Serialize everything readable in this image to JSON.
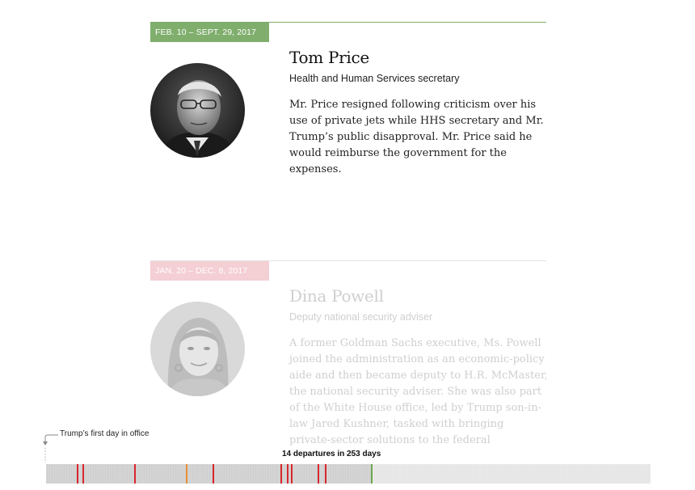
{
  "cards": [
    {
      "date_range": "FEB. 10 – SEPT. 29, 2017",
      "name": "Tom Price",
      "role": "Health and Human Services secretary",
      "description": "Mr. Price resigned following criticism over his use of private jets while HHS secretary and Mr. Trump’s public disapproval. Mr. Price said he would reimburse the government for the expenses.",
      "tag_color": "#7fae6d",
      "rule_color": "#7fae6d"
    },
    {
      "date_range": "JAN. 20 – DEC. 8, 2017",
      "name": "Dina Powell",
      "role": "Deputy national security adviser",
      "description": "A former Goldman Sachs executive, Ms. Powell joined the administration as an economic-policy aide and then became deputy to H.R. McMaster, the national security adviser. She was also part of the White House office, led by Trump son-in-law Jared Kushner, tasked with bringing private-sector solutions to the federal government.",
      "tag_color": "#f4cfd4",
      "rule_color": "#e3e3e3"
    }
  ],
  "timeline": {
    "first_day_label": "Trump’s first day in office",
    "departures_label": "14 departures in 253 days",
    "elapsed_fraction": 0.54,
    "colors": {
      "elapsed": "#cfcfcf",
      "remaining": "#e6e6e6",
      "departure": "#d9262d",
      "orange": "#e8913a",
      "current": "#6aa84f"
    }
  }
}
